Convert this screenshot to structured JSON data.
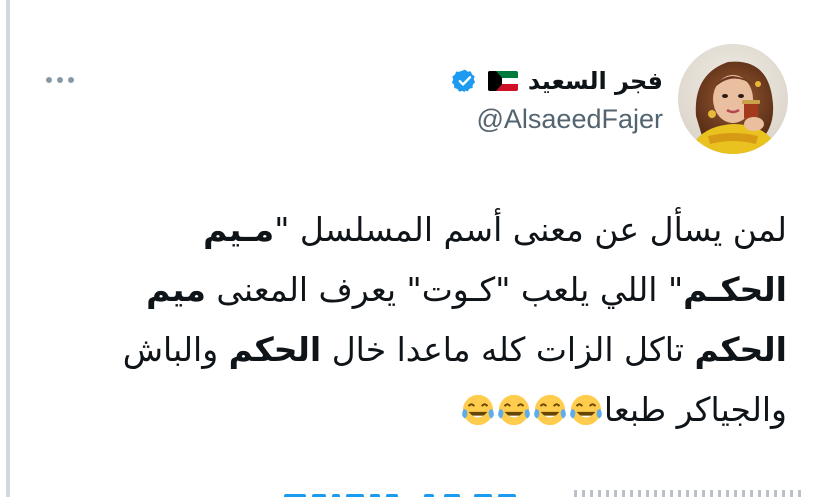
{
  "tweet": {
    "display_name": "فجر السعيد",
    "handle": "@AlsaeedFajer",
    "text": {
      "line1_normal": "لمن يسأل عن معنى أسم المسلسل \"",
      "line1_bold": "مـيم",
      "line2_bold": "الحكـم",
      "line2_normal": "\" اللي يلعب \"كـوت\" يعرف المعنى",
      "line3_bold": "ميم الحكم",
      "line3_normal": " تاكل الزات كله ماعدا خال",
      "line4_bold": "الحكم",
      "line4_normal": " والباش والجياكر طبعا"
    },
    "emoji_icons": [
      "face-with-tears-of-joy-icon",
      "face-with-tears-of-joy-icon",
      "face-with-tears-of-joy-icon",
      "face-with-tears-of-joy-icon"
    ]
  },
  "colors": {
    "text": "#0f1419",
    "handle": "#536471",
    "verified": "#1d9bf0",
    "flag_green": "#007a3d",
    "flag_red": "#ce1126"
  },
  "icons": {
    "more": "more-horizontal-icon",
    "verified": "verified-badge-icon",
    "flag": "kuwait-flag-icon"
  }
}
